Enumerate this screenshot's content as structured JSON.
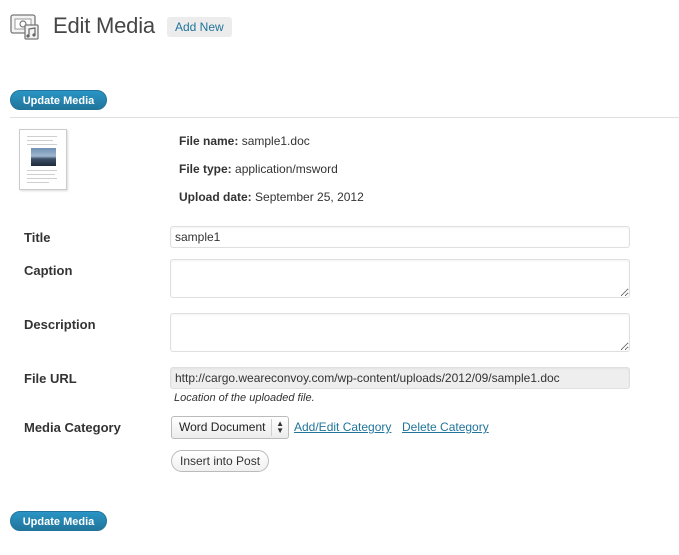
{
  "header": {
    "icon": "media-library-icon",
    "title": "Edit Media",
    "add_new_label": "Add New"
  },
  "actions": {
    "update_label": "Update Media"
  },
  "attachment": {
    "thumbnail_icon": "document-thumbnail-icon",
    "file_name_label": "File name:",
    "file_name": "sample1.doc",
    "file_type_label": "File type:",
    "file_type": "application/msword",
    "upload_date_label": "Upload date:",
    "upload_date": "September 25, 2012"
  },
  "form": {
    "title_label": "Title",
    "title_value": "sample1",
    "caption_label": "Caption",
    "caption_value": "",
    "description_label": "Description",
    "description_value": "",
    "file_url_label": "File URL",
    "file_url_value": "http://cargo.weareconvoy.com/wp-content/uploads/2012/09/sample1.doc",
    "file_url_hint": "Location of the uploaded file.",
    "media_category_label": "Media Category",
    "media_category_selected": "Word Document",
    "add_edit_category_label": "Add/Edit Category",
    "delete_category_label": "Delete Category",
    "insert_into_post_label": "Insert into Post"
  },
  "colors": {
    "accent": "#21759b",
    "primary_button_top": "#2a95c5",
    "readonly_field": "#eeeeee"
  }
}
